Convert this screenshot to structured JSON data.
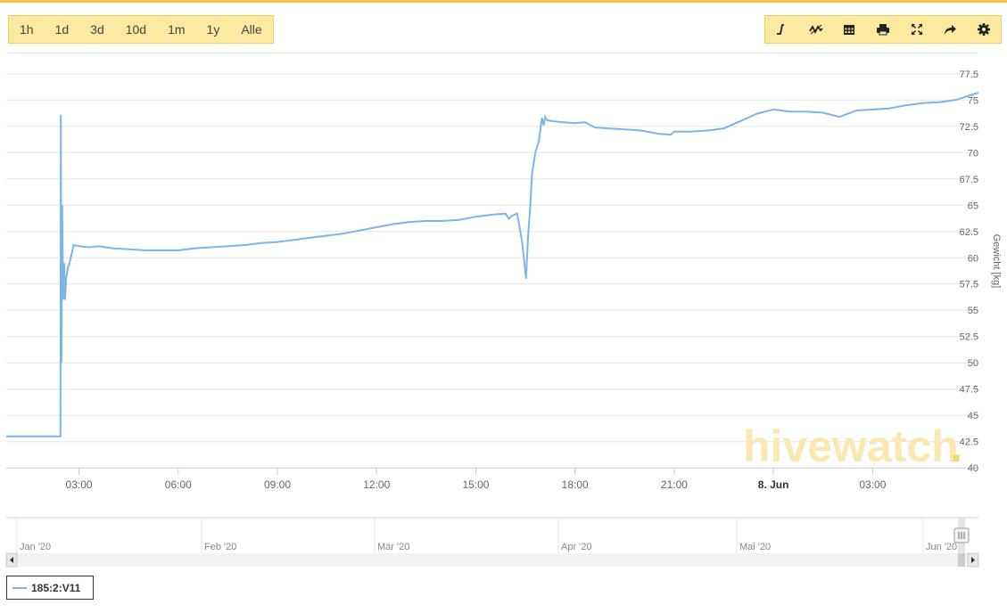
{
  "toolbar": {
    "ranges": [
      "1h",
      "1d",
      "3d",
      "10d",
      "1m",
      "1y",
      "Alle"
    ],
    "tools": [
      "line-chart-icon",
      "trend-chart-icon",
      "calendar-icon",
      "print-icon",
      "fullscreen-icon",
      "share-icon",
      "settings-icon"
    ]
  },
  "watermark": {
    "text_main": "hivewatch",
    "text_dot": "."
  },
  "colors": {
    "accent": "#f5c342",
    "toolbar_bg": "#fde9a0",
    "series": "#7cb5ec",
    "watermark": "#fbe8b0"
  },
  "chart_data": {
    "type": "line",
    "xlabel": "",
    "ylabel": "Gewicht [kg]",
    "ylim": [
      40,
      80
    ],
    "x_hours_range": [
      0.8,
      30.2
    ],
    "x_ticks": [
      {
        "h": 3,
        "label": "03:00",
        "bold": false
      },
      {
        "h": 6,
        "label": "06:00",
        "bold": false
      },
      {
        "h": 9,
        "label": "09:00",
        "bold": false
      },
      {
        "h": 12,
        "label": "12:00",
        "bold": false
      },
      {
        "h": 15,
        "label": "15:00",
        "bold": false
      },
      {
        "h": 18,
        "label": "18:00",
        "bold": false
      },
      {
        "h": 21,
        "label": "21:00",
        "bold": false
      },
      {
        "h": 24,
        "label": "8. Jun",
        "bold": true
      },
      {
        "h": 27,
        "label": "03:00",
        "bold": false
      }
    ],
    "y_ticks": [
      40,
      42.5,
      45,
      47.5,
      50,
      52.5,
      55,
      57.5,
      60,
      62.5,
      65,
      67.5,
      70,
      72.5,
      75,
      77.5
    ],
    "y_tick_labels": [
      "40",
      "42.5",
      "45",
      "47.5",
      "50",
      "52.5",
      "55",
      "57.5",
      "60",
      "62.5",
      "65",
      "67.5",
      "70",
      "72.5",
      "75",
      "77.5"
    ],
    "grid": true,
    "legend": "bottom-left",
    "series": [
      {
        "name": "185:2:V11",
        "x": [
          0.8,
          2.44,
          2.45,
          2.47,
          2.49,
          2.52,
          2.55,
          2.58,
          2.61,
          2.66,
          2.72,
          2.84,
          3.0,
          3.3,
          3.6,
          4.0,
          4.5,
          5.0,
          5.5,
          6.0,
          6.5,
          7.0,
          7.5,
          8.0,
          8.5,
          9.0,
          9.5,
          10.0,
          10.5,
          11.0,
          11.5,
          12.0,
          12.5,
          13.0,
          13.5,
          14.0,
          14.5,
          15.0,
          15.5,
          15.9,
          16.0,
          16.1,
          16.25,
          16.4,
          16.52,
          16.58,
          16.65,
          16.7,
          16.8,
          16.9,
          17.0,
          17.05,
          17.1,
          17.15,
          17.3,
          17.6,
          18.0,
          18.3,
          18.6,
          19.0,
          19.5,
          20.0,
          20.5,
          20.9,
          21.0,
          21.5,
          22.0,
          22.5,
          23.0,
          23.5,
          24.0,
          24.5,
          25.0,
          25.5,
          26.0,
          26.5,
          27.0,
          27.5,
          28.0,
          28.5,
          29.0,
          29.5,
          30.2
        ],
        "values": [
          43.0,
          43.0,
          73.6,
          50.0,
          65.0,
          56.0,
          59.5,
          56.0,
          58.0,
          59.0,
          59.6,
          61.2,
          61.1,
          61.0,
          61.1,
          60.9,
          60.8,
          60.7,
          60.7,
          60.7,
          60.9,
          61.0,
          61.1,
          61.2,
          61.4,
          61.5,
          61.7,
          61.9,
          62.1,
          62.3,
          62.6,
          62.9,
          63.2,
          63.4,
          63.5,
          63.5,
          63.6,
          63.9,
          64.1,
          64.2,
          63.7,
          64.0,
          64.2,
          61.5,
          58.0,
          62.0,
          65.0,
          68.0,
          70.0,
          71.0,
          73.3,
          72.6,
          73.4,
          73.1,
          73.0,
          72.9,
          72.8,
          72.9,
          72.4,
          72.3,
          72.2,
          72.1,
          71.8,
          71.7,
          72.0,
          72.0,
          72.1,
          72.3,
          73.0,
          73.7,
          74.1,
          73.9,
          73.9,
          73.8,
          73.4,
          74.0,
          74.1,
          74.2,
          74.5,
          74.7,
          74.8,
          75.0,
          75.7
        ]
      }
    ],
    "navigator": {
      "labels": [
        "Jan '20",
        "Feb '20",
        "Mär '20",
        "Apr '20",
        "Mai '20",
        "Jun '20"
      ]
    }
  }
}
